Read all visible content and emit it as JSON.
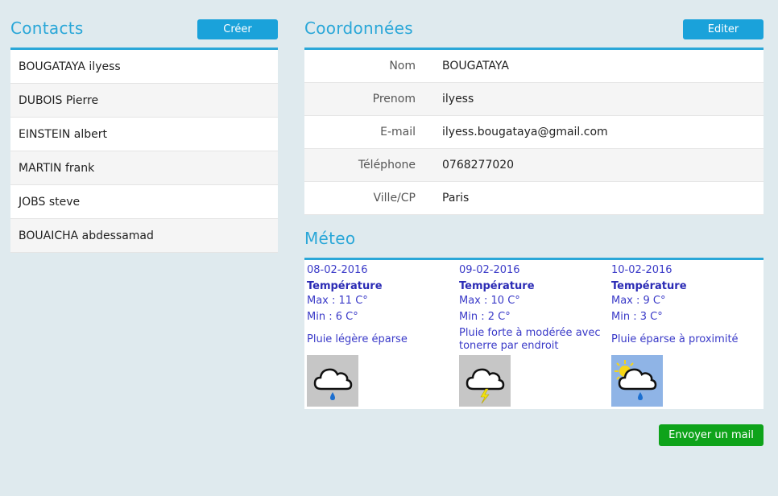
{
  "contacts": {
    "title": "Contacts",
    "create_label": "Créer",
    "items": [
      "BOUGATAYA ilyess",
      "DUBOIS Pierre",
      "EINSTEIN albert",
      "MARTIN frank",
      "JOBS steve",
      "BOUAICHA abdessamad"
    ]
  },
  "details": {
    "title": "Coordonnées",
    "edit_label": "Editer",
    "rows": [
      {
        "label": "Nom",
        "value": "BOUGATAYA"
      },
      {
        "label": "Prenom",
        "value": "ilyess"
      },
      {
        "label": "E-mail",
        "value": "ilyess.bougataya@gmail.com"
      },
      {
        "label": "Téléphone",
        "value": "0768277020"
      },
      {
        "label": "Ville/CP",
        "value": "Paris"
      }
    ]
  },
  "weather": {
    "title": "Méteo",
    "days": [
      {
        "date": "08-02-2016",
        "temp_label": "Température",
        "max": "Max : 11 C°",
        "min": "Min : 6 C°",
        "desc": "Pluie légère éparse",
        "icon": "rain-cloud-icon"
      },
      {
        "date": "09-02-2016",
        "temp_label": "Température",
        "max": "Max : 10 C°",
        "min": "Min : 2 C°",
        "desc": "Pluie forte à modérée avec tonerre par endroit",
        "icon": "thunder-cloud-icon"
      },
      {
        "date": "10-02-2016",
        "temp_label": "Température",
        "max": "Max : 9 C°",
        "min": "Min : 3 C°",
        "desc": "Pluie éparse à proximité",
        "icon": "sun-rain-cloud-icon"
      }
    ]
  },
  "send_mail_label": "Envoyer un mail",
  "colors": {
    "accent": "#2aa7d8",
    "button_blue": "#1aa2da",
    "button_green": "#0ea31a",
    "weather_text": "#3a3ac8"
  }
}
